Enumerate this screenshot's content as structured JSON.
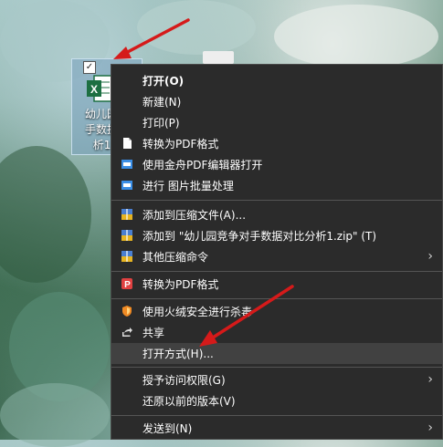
{
  "desktop": {
    "file_icon_name": "excel-file-icon",
    "file_label": "幼儿园竞\n手数据对\n析1.x"
  },
  "context_menu": {
    "items": [
      {
        "label": "打开(O)",
        "icon": ""
      },
      {
        "label": "新建(N)",
        "icon": ""
      },
      {
        "label": "打印(P)",
        "icon": ""
      },
      {
        "label": "转换为PDF格式",
        "icon": "document-icon"
      },
      {
        "label": "使用金舟PDF编辑器打开",
        "icon": "pdf-editor-icon"
      },
      {
        "label": "进行 图片批量处理",
        "icon": "image-batch-icon"
      },
      {
        "label": "添加到压缩文件(A)...",
        "icon": "archive-icon"
      },
      {
        "label": "添加到 \"幼儿园竞争对手数据对比分析1.zip\" (T)",
        "icon": "archive-icon"
      },
      {
        "label": "其他压缩命令",
        "icon": "archive-icon"
      },
      {
        "label": "转换为PDF格式",
        "icon": "pdf-convert-icon"
      },
      {
        "label": "使用火绒安全进行杀毒",
        "icon": "shield-icon"
      },
      {
        "label": "共享",
        "icon": "share-icon"
      },
      {
        "label": "打开方式(H)...",
        "icon": ""
      },
      {
        "label": "授予访问权限(G)",
        "icon": ""
      },
      {
        "label": "还原以前的版本(V)",
        "icon": ""
      },
      {
        "label": "发送到(N)",
        "icon": ""
      }
    ]
  },
  "colors": {
    "menu_bg": "#2b2b2b",
    "hover_bg": "#414141",
    "arrow_red": "#d51a1a",
    "excel_green": "#1d6f42"
  }
}
